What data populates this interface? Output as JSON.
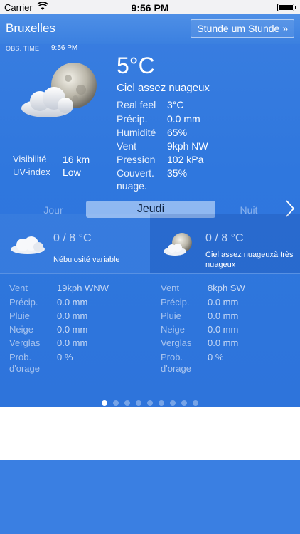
{
  "status": {
    "carrier": "Carrier",
    "time": "9:56 PM",
    "battery_level": 1.0
  },
  "header": {
    "city": "Bruxelles",
    "hourly_button": "Stunde um Stunde »"
  },
  "obs": {
    "label": "OBS. TIME",
    "time": "9:56 PM"
  },
  "current": {
    "temp": "5°C",
    "condition": "Ciel assez nuageux",
    "icon": "moon-cloud-icon",
    "details": [
      {
        "label": "Real feel",
        "value": "3°C"
      },
      {
        "label": "Précip.",
        "value": "0.0 mm"
      },
      {
        "label": "Humidité",
        "value": "65%"
      },
      {
        "label": "Vent",
        "value": "9kph NW"
      },
      {
        "label": "Pression",
        "value": "102 kPa"
      },
      {
        "label": "Couvert.",
        "value": "35%"
      },
      {
        "label": "nuage.",
        "value": ""
      }
    ],
    "left_details": [
      {
        "label": "Visibilité",
        "value": "16 km"
      },
      {
        "label": "UV-index",
        "value": "Low"
      }
    ]
  },
  "selector": {
    "prev": "Jour",
    "current": "Jeudi",
    "next": "Nuit"
  },
  "forecast": {
    "day": {
      "temp": "0 / 8 °C",
      "desc": "Nébulosité variable",
      "icon": "cloud-icon"
    },
    "night": {
      "temp": "0 / 8 °C",
      "desc_line1": "Ciel assez nuageuxà très",
      "desc_line2": "nuageux",
      "icon": "moon-cloud-icon"
    }
  },
  "day_details": [
    {
      "label": "Vent",
      "value": "19kph WNW"
    },
    {
      "label": "Précip.",
      "value": "0.0 mm"
    },
    {
      "label": "Pluie",
      "value": "0.0 mm"
    },
    {
      "label": "Neige",
      "value": "0.0 mm"
    },
    {
      "label": "Verglas",
      "value": "0.0 mm"
    },
    {
      "label": "Prob.",
      "label2": "d'orage",
      "value": "0 %"
    }
  ],
  "night_details": [
    {
      "label": "Vent",
      "value": "8kph SW"
    },
    {
      "label": "Précip.",
      "value": "0.0 mm"
    },
    {
      "label": "Pluie",
      "value": "0.0 mm"
    },
    {
      "label": "Neige",
      "value": "0.0 mm"
    },
    {
      "label": "Verglas",
      "value": "0.0 mm"
    },
    {
      "label": "Prob.",
      "label2": "d'orage",
      "value": "0 %"
    }
  ],
  "pager": {
    "total": 9,
    "active": 1
  },
  "colors": {
    "main_bg": "#2f77de",
    "header_bg": "#4e8fe6",
    "selected_tab": "#8fb8f1"
  }
}
